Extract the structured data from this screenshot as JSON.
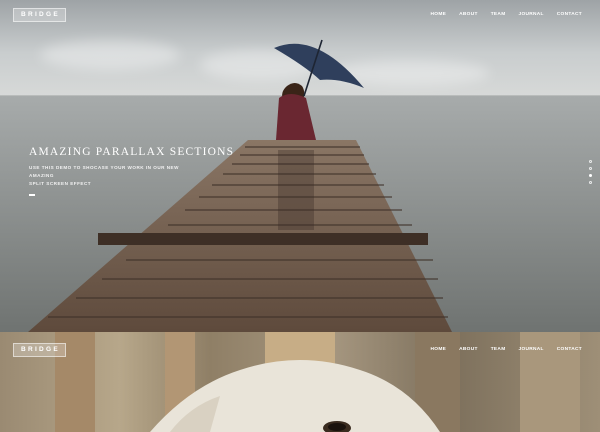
{
  "header": {
    "logo_text": "BRIDGE",
    "nav": [
      "HOME",
      "ABOUT",
      "TEAM",
      "JOURNAL",
      "CONTACT"
    ]
  },
  "hero": {
    "title": "AMAZING PARALLAX SECTIONS",
    "subtitle_line1": "USE THIS DEMO TO SHOCASE YOUR WORK IN OUR NEW AMAZING",
    "subtitle_line2": "SPLIT SCREEN EFFECT",
    "slider_dots": {
      "count": 4,
      "active_index": 2
    }
  },
  "header2": {
    "logo_text": "BRIDGE",
    "nav": [
      "HOME",
      "ABOUT",
      "TEAM",
      "JOURNAL",
      "CONTACT"
    ]
  },
  "colors": {
    "text": "#ffffff",
    "sea": "#8e9291",
    "pier": "#6b5647",
    "umbrella": "#2f3f5c",
    "coat": "#6a2731"
  }
}
